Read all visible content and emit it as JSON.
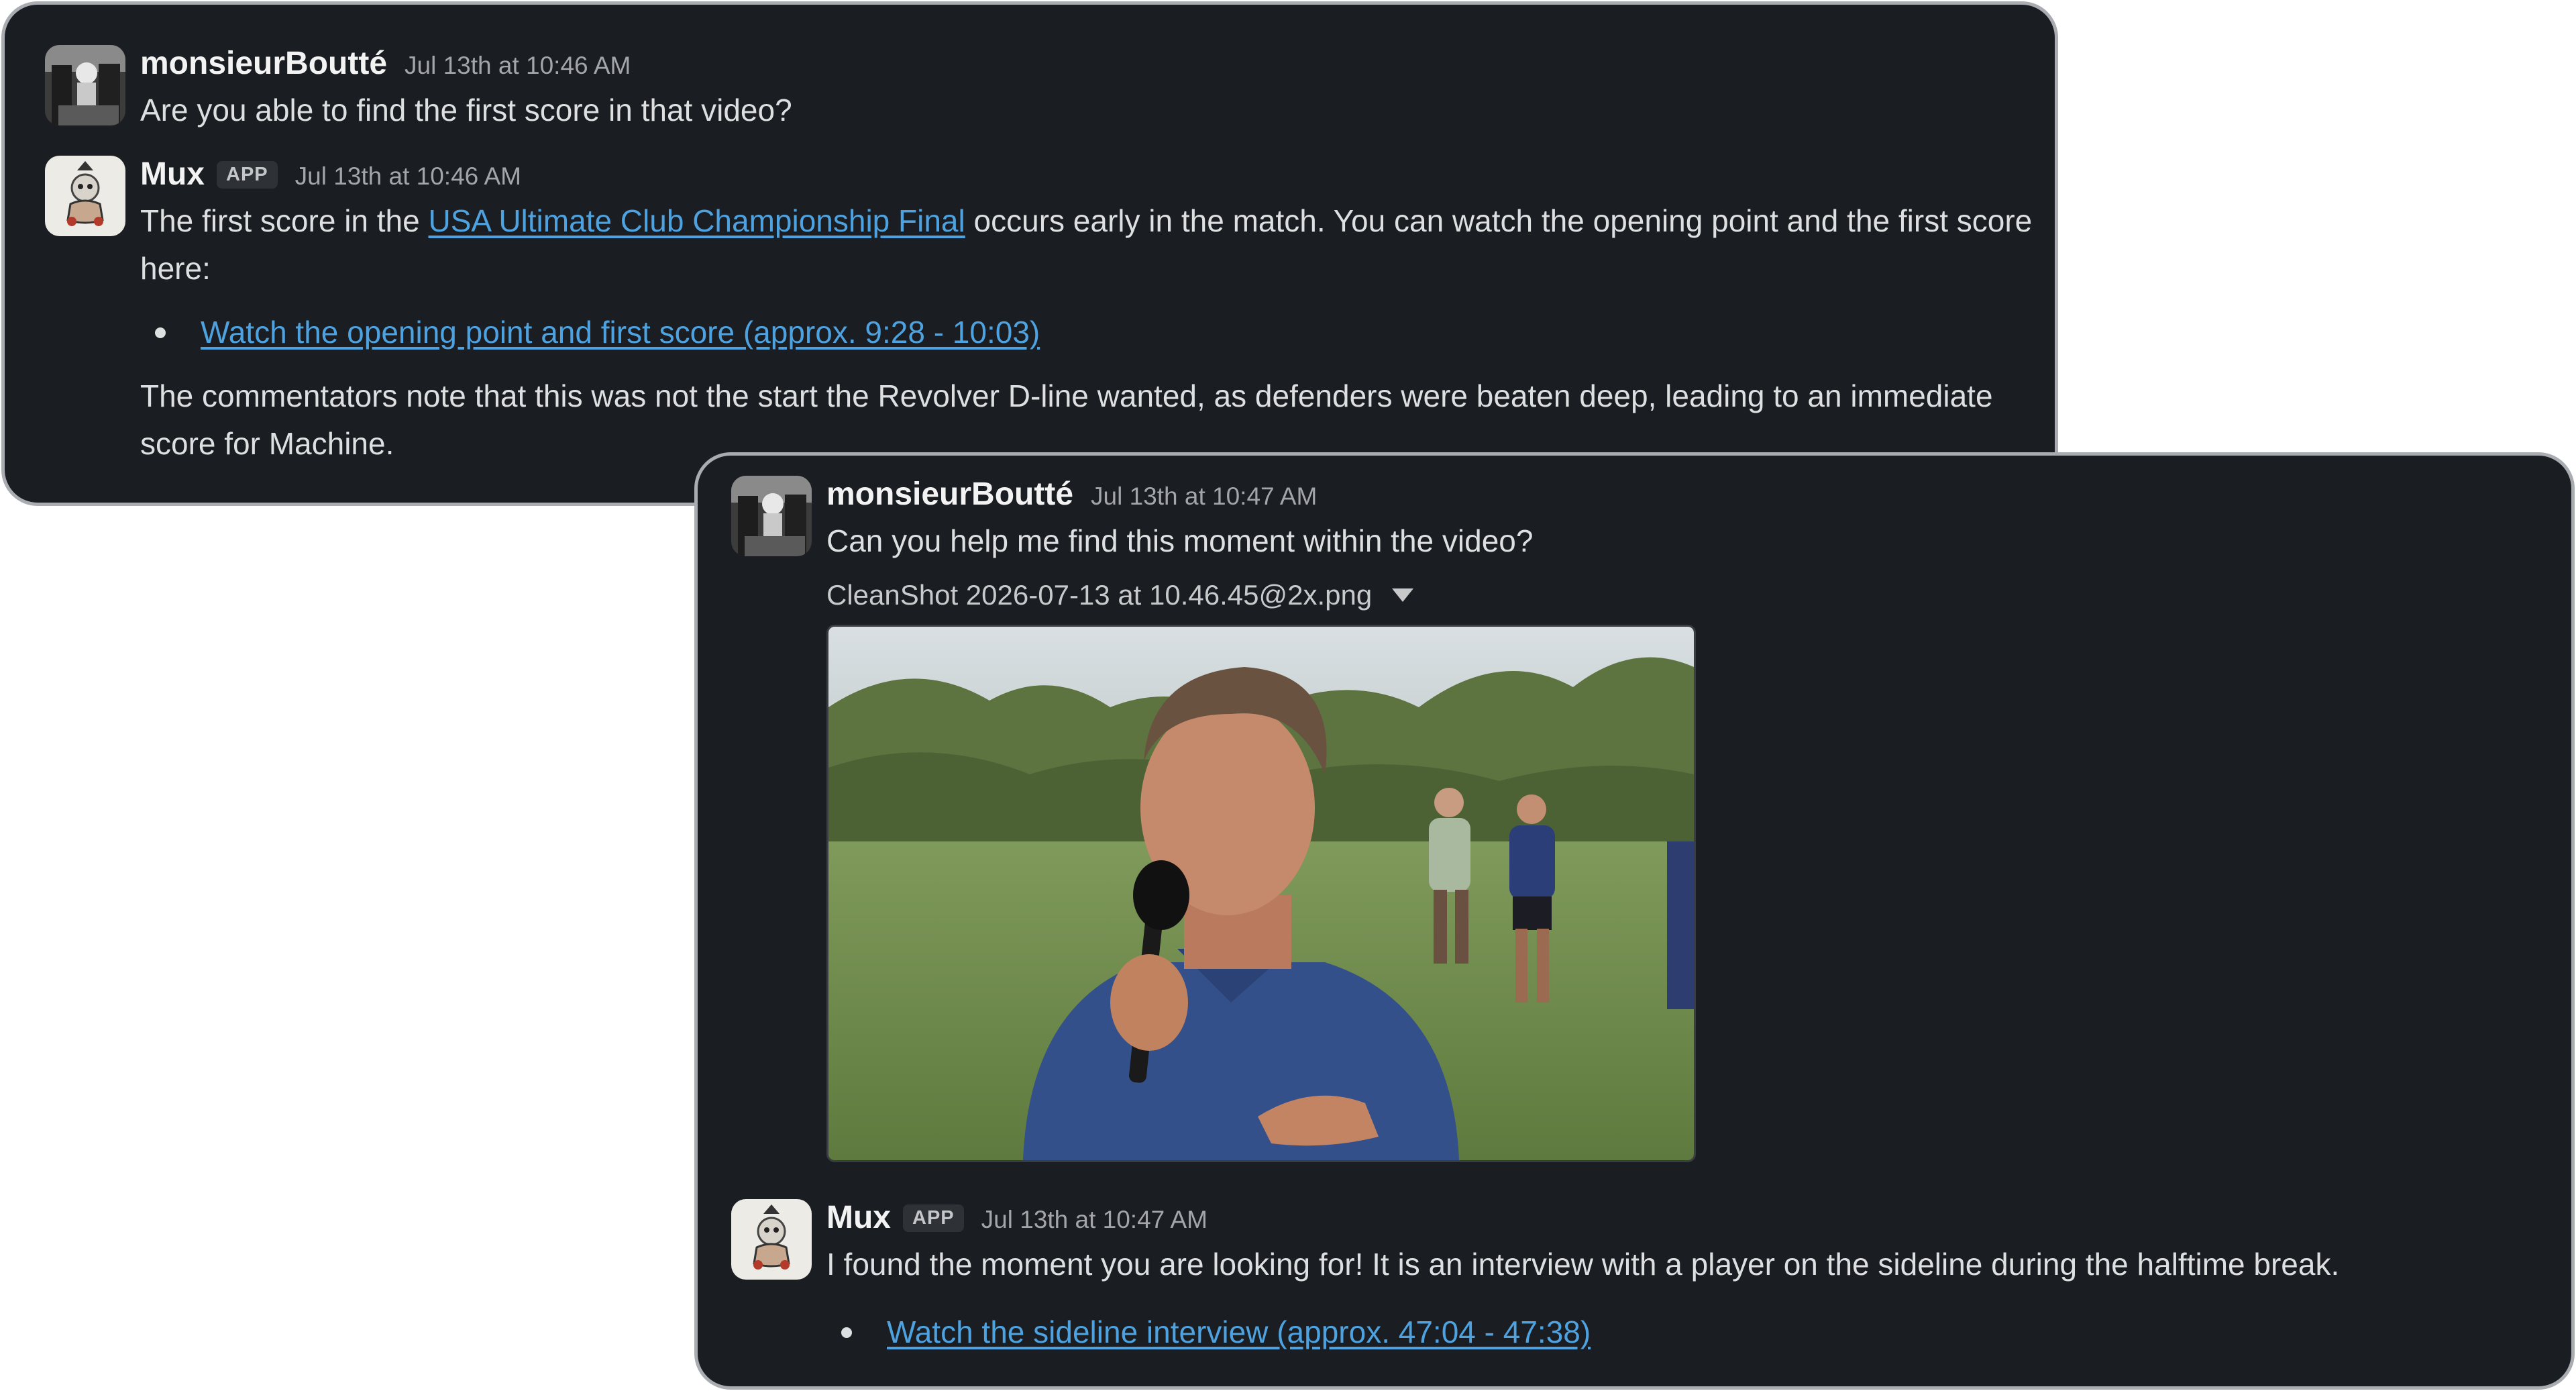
{
  "thread_a": {
    "msg1": {
      "author": "monsieurBoutté",
      "time": "Jul 13th at 10:46 AM",
      "text": "Are you able to find the first score in that video?"
    },
    "msg2": {
      "author": "Mux",
      "badge": "APP",
      "time": "Jul 13th at 10:46 AM",
      "text_before": "The first score in the ",
      "link": "USA Ultimate Club Championship Final",
      "text_after": " occurs early in the match. You can watch the opening point and the first score here:",
      "bullet_link": "Watch the opening point and first score (approx. 9:28 - 10:03)",
      "note": "The commentators note that this was not the start the Revolver D-line wanted, as defenders were beaten deep, leading to an immediate score for Machine."
    }
  },
  "thread_b": {
    "msg1": {
      "author": "monsieurBoutté",
      "time": "Jul 13th at 10:47 AM",
      "text": "Can you help me find this moment within the video?",
      "attachment_name": "CleanShot 2026-07-13 at 10.46.45@2x.png"
    },
    "msg2": {
      "author": "Mux",
      "badge": "APP",
      "time": "Jul 13th at 10:47 AM",
      "text": "I found the moment you are looking for! It is an interview with a player on the sideline during the halftime break.",
      "bullet_link": "Watch the sideline interview (approx. 47:04 - 47:38)"
    }
  },
  "colors": {
    "panel_bg": "#1a1d21",
    "link": "#4ea2e0",
    "text": "#dedfe0"
  }
}
